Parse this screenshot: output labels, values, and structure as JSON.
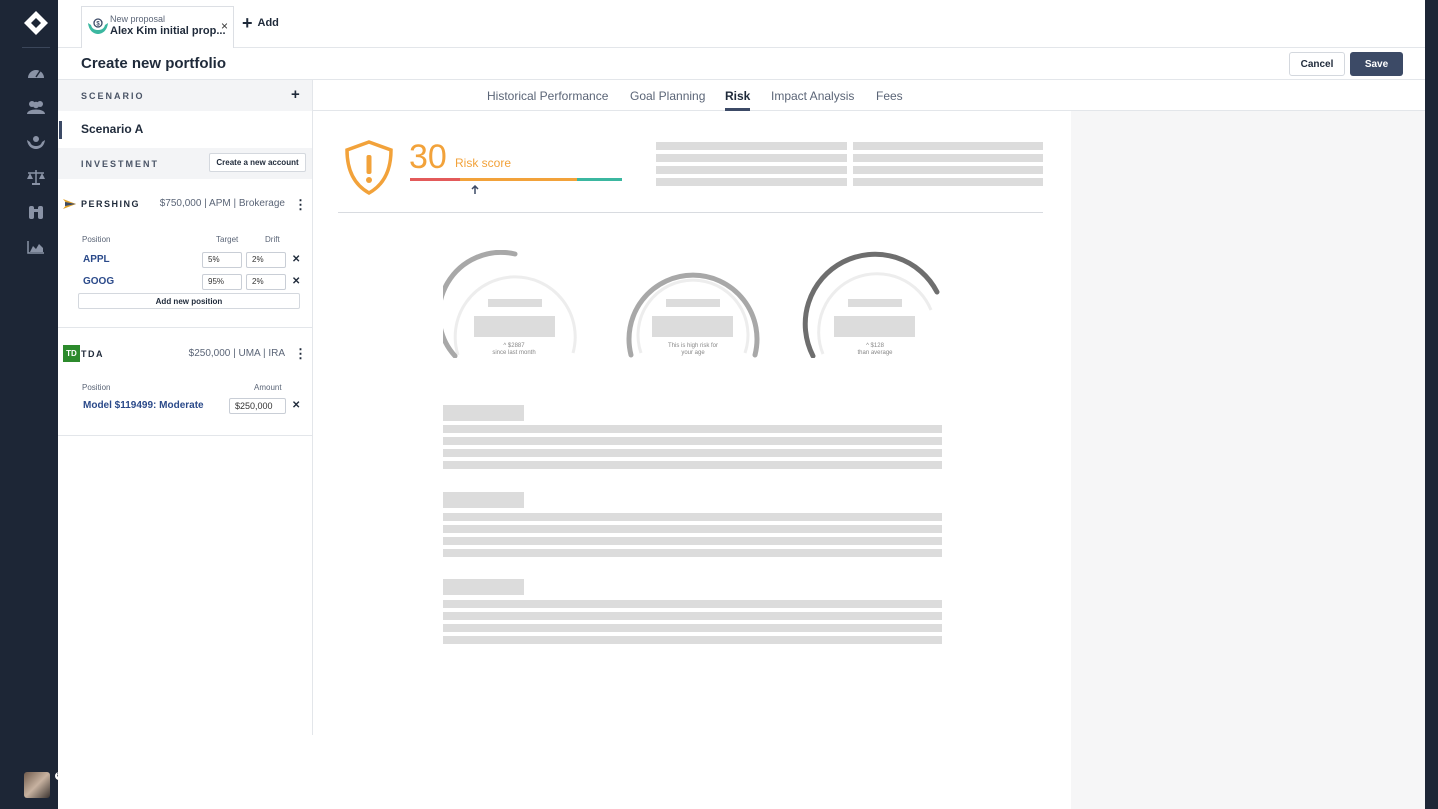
{
  "doc_tab": {
    "subtitle": "New proposal",
    "name": "Alex Kim initial prop...",
    "close": "×"
  },
  "add_tab": {
    "icon": "+",
    "label": "Add"
  },
  "page": {
    "title": "Create new portfolio",
    "cancel": "Cancel",
    "save": "Save"
  },
  "scenario": {
    "header": "SCENARIO",
    "add": "+",
    "items": [
      {
        "label": "Scenario A"
      }
    ]
  },
  "investment": {
    "header": "INVESTMENT",
    "create_account": "Create a new account",
    "accounts": [
      {
        "name": "PERSHING",
        "meta": "$750,000 | APM | Brokerage",
        "columns": {
          "position": "Position",
          "target": "Target",
          "drift": "Drift"
        },
        "positions": [
          {
            "ticker": "APPL",
            "target": "5%",
            "drift": "2%"
          },
          {
            "ticker": "GOOG",
            "target": "95%",
            "drift": "2%"
          }
        ],
        "add_position": "Add new position"
      },
      {
        "name": "TDA",
        "logo_text": "TD",
        "meta": "$250,000 | UMA | IRA",
        "columns": {
          "position": "Position",
          "amount": "Amount"
        },
        "positions": [
          {
            "name": "Model $119499: Moderate",
            "amount": "$250,000"
          }
        ]
      }
    ]
  },
  "subtabs": [
    {
      "label": "Historical Performance"
    },
    {
      "label": "Goal Planning"
    },
    {
      "label": "Risk",
      "active": true
    },
    {
      "label": "Impact Analysis"
    },
    {
      "label": "Fees"
    }
  ],
  "risk": {
    "score": "30",
    "score_label": "Risk score",
    "scale_colors": [
      "#e35a5a",
      "#f2a23a",
      "#3bb7a0"
    ],
    "gauges": [
      {
        "caption_line1": "^ $2887",
        "caption_line2": "since last month",
        "level": 0.55
      },
      {
        "caption_line1": "This is high risk for",
        "caption_line2": "your age",
        "level": 1.0
      },
      {
        "caption_line1": "^ $128",
        "caption_line2": "than average",
        "level": 0.8
      }
    ]
  },
  "colors": {
    "accent": "#3c4a66",
    "link": "#2b4a8a",
    "warning": "#f2a23a",
    "rail": "#1d2636"
  }
}
